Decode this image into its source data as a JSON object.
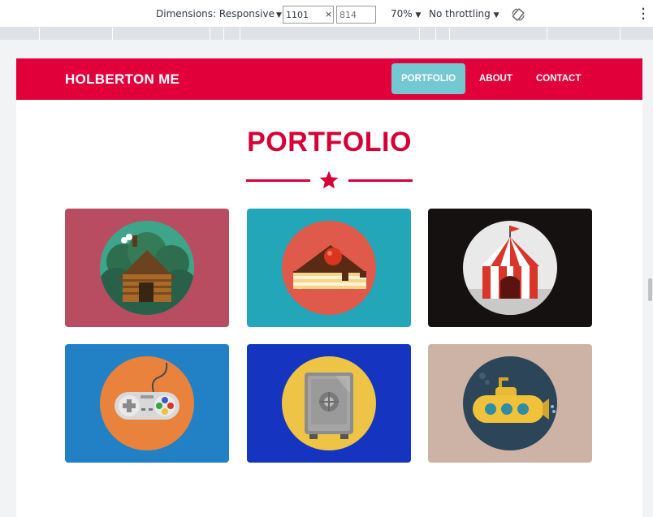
{
  "devtools": {
    "dimensions_label": "Dimensions: Responsive",
    "width_value": "1101",
    "times_sign": "×",
    "height_placeholder": "814",
    "zoom": "70%",
    "throttling": "No throttling"
  },
  "site": {
    "brand": "HOLBERTON ME",
    "nav": [
      {
        "label": "PORTFOLIO",
        "active": true
      },
      {
        "label": "ABOUT",
        "active": false
      },
      {
        "label": "CONTACT",
        "active": false
      }
    ],
    "page_title": "PORTFOLIO"
  },
  "colors": {
    "brand_red": "#e2003b",
    "active_nav": "#73c8d2"
  },
  "portfolio": [
    {
      "icon": "cabin-icon",
      "background": "#b84d62"
    },
    {
      "icon": "cake-icon",
      "background": "#22a6b8"
    },
    {
      "icon": "circus-tent-icon",
      "background": "#151111"
    },
    {
      "icon": "game-controller-icon",
      "background": "#2181c4"
    },
    {
      "icon": "safe-icon",
      "background": "#1535c0"
    },
    {
      "icon": "submarine-icon",
      "background": "#cdb3a5"
    }
  ]
}
